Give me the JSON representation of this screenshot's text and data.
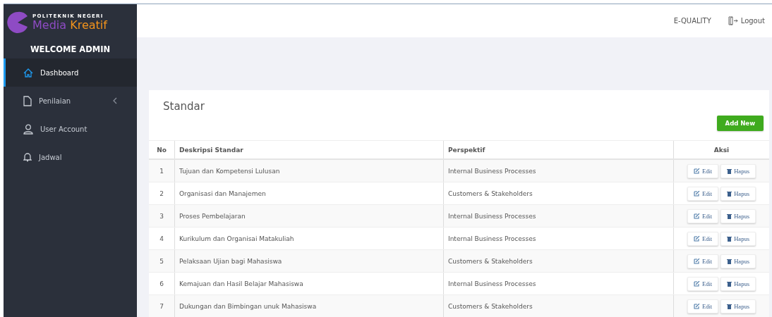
{
  "sidebar": {
    "logo": {
      "top_line": "POLITEKNIK NEGERI",
      "word_1": "Media",
      "word_2": "Kreatif"
    },
    "welcome": "WELCOME ADMIN",
    "items": [
      {
        "label": "Dashboard",
        "kind": "link",
        "selected": true
      },
      {
        "label": "Penilaian",
        "kind": "submenu",
        "selected": false
      },
      {
        "label": "User Account",
        "kind": "link",
        "selected": false
      },
      {
        "label": "Jadwal",
        "kind": "link",
        "selected": false
      }
    ]
  },
  "header": {
    "links": [
      "E-QUALITY"
    ],
    "logout": "Logout"
  },
  "card": {
    "title": "Standar",
    "add_button": "Add New",
    "table": {
      "columns": [
        "No",
        "Deskripsi Standar",
        "Perspektif",
        "Aksi"
      ],
      "rows": [
        {
          "no": "1",
          "deskripsi": "Tujuan dan Kompetensi Lulusan",
          "perspektif": "Internal Business Processes",
          "edit": "Edit",
          "delete": "Hapus"
        },
        {
          "no": "2",
          "deskripsi": "Organisasi dan Manajemen",
          "perspektif": "Customers & Stakeholders",
          "edit": "Edit",
          "delete": "Hapus"
        },
        {
          "no": "3",
          "deskripsi": "Proses Pembelajaran",
          "perspektif": "Internal Business Processes",
          "edit": "Edit",
          "delete": "Hapus"
        },
        {
          "no": "4",
          "deskripsi": "Kurikulum dan Organisai Matakuliah",
          "perspektif": "Internal Business Processes",
          "edit": "Edit",
          "delete": "Hapus"
        },
        {
          "no": "5",
          "deskripsi": "Pelaksaan Ujian bagi Mahasiswa",
          "perspektif": "Customers & Stakeholders",
          "edit": "Edit",
          "delete": "Hapus"
        },
        {
          "no": "6",
          "deskripsi": "Kemajuan dan Hasil Belajar Mahasiswa",
          "perspektif": "Internal Business Processes",
          "edit": "Edit",
          "delete": "Hapus"
        },
        {
          "no": "7",
          "deskripsi": "Dukungan dan Bimbingan unuk Mahasiswa",
          "perspektif": "Customers & Stakeholders",
          "edit": "Edit",
          "delete": "Hapus"
        }
      ]
    }
  }
}
